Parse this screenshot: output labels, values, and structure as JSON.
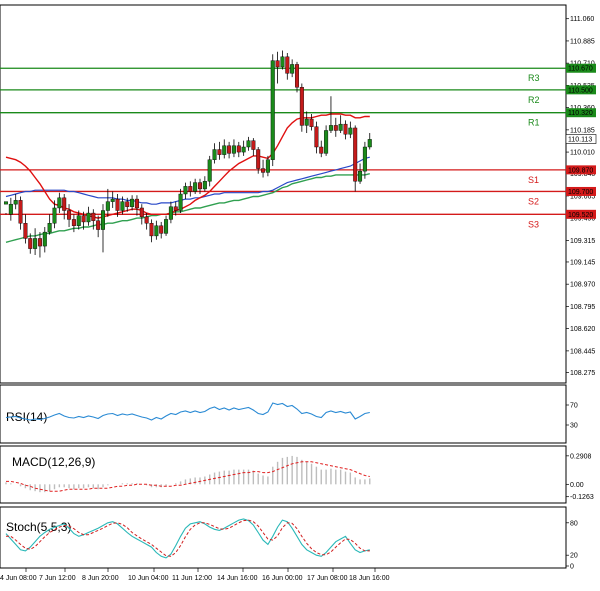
{
  "chart_data": [
    {
      "type": "candlestick",
      "pane": "price",
      "ylim": [
        108.2,
        111.16
      ],
      "y_ticks": [
        "111.060",
        "110.885",
        "110.710",
        "110.535",
        "110.360",
        "110.185",
        "110.010",
        "109.840",
        "109.665",
        "109.490",
        "109.315",
        "109.145",
        "108.970",
        "108.795",
        "108.620",
        "108.445",
        "108.275"
      ],
      "last_price": "110.113",
      "levels": [
        {
          "name": "R3",
          "value": 110.67,
          "label": "110.670",
          "color": "#1a8a1a"
        },
        {
          "name": "R2",
          "value": 110.5,
          "label": "110.500",
          "color": "#1a8a1a"
        },
        {
          "name": "R1",
          "value": 110.32,
          "label": "110.320",
          "color": "#1a8a1a"
        },
        {
          "name": "S1",
          "value": 109.87,
          "label": "109.870",
          "color": "#d41a1a"
        },
        {
          "name": "S2",
          "value": 109.7,
          "label": "109.700",
          "color": "#d41a1a"
        },
        {
          "name": "S3",
          "value": 109.52,
          "label": "109.520",
          "color": "#d41a1a"
        }
      ],
      "candles": [
        [
          109.6,
          109.62,
          109.53,
          109.52
        ],
        [
          109.52,
          109.6,
          109.65,
          109.47
        ],
        [
          109.6,
          109.63,
          109.68,
          109.56
        ],
        [
          109.63,
          109.45,
          109.66,
          109.4
        ],
        [
          109.45,
          109.33,
          109.52,
          109.29
        ],
        [
          109.33,
          109.25,
          109.37,
          109.21
        ],
        [
          109.25,
          109.33,
          109.41,
          109.2
        ],
        [
          109.33,
          109.27,
          109.38,
          109.18
        ],
        [
          109.27,
          109.38,
          109.42,
          109.22
        ],
        [
          109.38,
          109.45,
          109.52,
          109.36
        ],
        [
          109.45,
          109.57,
          109.63,
          109.41
        ],
        [
          109.57,
          109.65,
          109.69,
          109.53
        ],
        [
          109.65,
          109.55,
          109.68,
          109.48
        ],
        [
          109.55,
          109.48,
          109.6,
          109.42
        ],
        [
          109.48,
          109.43,
          109.52,
          109.38
        ],
        [
          109.43,
          109.51,
          109.55,
          109.4
        ],
        [
          109.51,
          109.46,
          109.54,
          109.4
        ],
        [
          109.46,
          109.53,
          109.58,
          109.43
        ],
        [
          109.53,
          109.47,
          109.56,
          109.4
        ],
        [
          109.47,
          109.4,
          109.51,
          109.34
        ],
        [
          109.4,
          109.55,
          109.6,
          109.22
        ],
        [
          109.55,
          109.62,
          109.72,
          109.5
        ],
        [
          109.62,
          109.64,
          109.7,
          109.57
        ],
        [
          109.64,
          109.55,
          109.68,
          109.5
        ],
        [
          109.55,
          109.62,
          109.66,
          109.52
        ],
        [
          109.62,
          109.58,
          109.65,
          109.54
        ],
        [
          109.58,
          109.64,
          109.67,
          109.55
        ],
        [
          109.64,
          109.57,
          109.67,
          109.51
        ],
        [
          109.57,
          109.5,
          109.6,
          109.44
        ],
        [
          109.5,
          109.45,
          109.53,
          109.4
        ],
        [
          109.45,
          109.35,
          109.48,
          109.3
        ],
        [
          109.35,
          109.43,
          109.47,
          109.32
        ],
        [
          109.43,
          109.37,
          109.46,
          109.33
        ],
        [
          109.37,
          109.48,
          109.51,
          109.35
        ],
        [
          109.48,
          109.58,
          109.62,
          109.45
        ],
        [
          109.58,
          109.55,
          109.62,
          109.51
        ],
        [
          109.55,
          109.68,
          109.72,
          109.53
        ],
        [
          109.68,
          109.74,
          109.77,
          109.64
        ],
        [
          109.74,
          109.7,
          109.78,
          109.66
        ],
        [
          109.7,
          109.77,
          109.8,
          109.68
        ],
        [
          109.77,
          109.72,
          109.8,
          109.68
        ],
        [
          109.72,
          109.78,
          109.82,
          109.7
        ],
        [
          109.78,
          109.95,
          109.98,
          109.74
        ],
        [
          109.95,
          110.03,
          110.08,
          109.92
        ],
        [
          110.03,
          109.99,
          110.09,
          109.95
        ],
        [
          109.99,
          110.06,
          110.11,
          109.96
        ],
        [
          110.06,
          110.0,
          110.09,
          109.96
        ],
        [
          110.0,
          110.06,
          110.11,
          109.97
        ],
        [
          110.06,
          110.01,
          110.09,
          109.97
        ],
        [
          110.01,
          110.05,
          110.1,
          109.98
        ],
        [
          110.05,
          110.1,
          110.13,
          110.02
        ],
        [
          110.1,
          110.03,
          110.12,
          109.98
        ],
        [
          110.03,
          109.88,
          110.05,
          109.84
        ],
        [
          109.88,
          109.85,
          109.95,
          109.81
        ],
        [
          109.85,
          109.95,
          109.98,
          109.82
        ],
        [
          109.95,
          110.73,
          110.78,
          109.9
        ],
        [
          110.73,
          110.68,
          110.8,
          110.55
        ],
        [
          110.68,
          110.76,
          110.81,
          110.66
        ],
        [
          110.76,
          110.63,
          110.79,
          110.58
        ],
        [
          110.63,
          110.7,
          110.74,
          110.6
        ],
        [
          110.7,
          110.52,
          110.72,
          110.48
        ],
        [
          110.52,
          110.22,
          110.55,
          110.17
        ],
        [
          110.22,
          110.27,
          110.33,
          110.16
        ],
        [
          110.27,
          110.21,
          110.31,
          110.18
        ],
        [
          110.21,
          110.05,
          110.25,
          110.0
        ],
        [
          110.05,
          110.0,
          110.1,
          109.97
        ],
        [
          110.0,
          110.18,
          110.22,
          109.98
        ],
        [
          110.18,
          110.22,
          110.45,
          110.16
        ],
        [
          110.22,
          110.18,
          110.28,
          110.13
        ],
        [
          110.18,
          110.23,
          110.3,
          110.16
        ],
        [
          110.23,
          110.15,
          110.26,
          110.11
        ],
        [
          110.15,
          110.2,
          110.25,
          110.12
        ],
        [
          110.2,
          109.78,
          110.22,
          109.7
        ],
        [
          109.78,
          109.86,
          109.92,
          109.76
        ],
        [
          109.86,
          110.05,
          110.09,
          109.8
        ],
        [
          110.05,
          110.11,
          110.16,
          110.03
        ]
      ],
      "ma_red": [
        109.97,
        109.96,
        109.95,
        109.93,
        109.9,
        109.86,
        109.81,
        109.76,
        109.7,
        109.64,
        109.6,
        109.59,
        109.57,
        109.56,
        109.54,
        109.53,
        109.52,
        109.51,
        109.5,
        109.49,
        109.5,
        109.51,
        109.52,
        109.53,
        109.54,
        109.55,
        109.56,
        109.56,
        109.55,
        109.53,
        109.52,
        109.52,
        109.52,
        109.52,
        109.53,
        109.55,
        109.56,
        109.58,
        109.6,
        109.63,
        109.65,
        109.67,
        109.7,
        109.74,
        109.78,
        109.82,
        109.86,
        109.89,
        109.92,
        109.94,
        109.96,
        109.98,
        109.98,
        109.97,
        109.96,
        110.0,
        110.06,
        110.13,
        110.2,
        110.24,
        110.27,
        110.28,
        110.28,
        110.28,
        110.29,
        110.3,
        110.3,
        110.31,
        110.31,
        110.31,
        110.3,
        110.3,
        110.28,
        110.28,
        110.29,
        110.29
      ],
      "ma_blue": [
        109.66,
        109.67,
        109.68,
        109.69,
        109.7,
        109.7,
        109.71,
        109.71,
        109.71,
        109.71,
        109.71,
        109.71,
        109.71,
        109.7,
        109.7,
        109.69,
        109.68,
        109.67,
        109.66,
        109.65,
        109.65,
        109.65,
        109.65,
        109.64,
        109.64,
        109.63,
        109.63,
        109.62,
        109.61,
        109.61,
        109.6,
        109.6,
        109.61,
        109.61,
        109.61,
        109.62,
        109.63,
        109.64,
        109.64,
        109.65,
        109.65,
        109.66,
        109.67,
        109.68,
        109.68,
        109.69,
        109.69,
        109.69,
        109.69,
        109.69,
        109.69,
        109.69,
        109.69,
        109.7,
        109.7,
        109.71,
        109.73,
        109.75,
        109.77,
        109.78,
        109.79,
        109.8,
        109.81,
        109.82,
        109.83,
        109.84,
        109.85,
        109.86,
        109.87,
        109.88,
        109.89,
        109.9,
        109.92,
        109.94,
        109.96,
        109.97
      ],
      "ma_green": [
        109.3,
        109.31,
        109.32,
        109.33,
        109.34,
        109.35,
        109.35,
        109.36,
        109.37,
        109.37,
        109.38,
        109.39,
        109.39,
        109.4,
        109.41,
        109.41,
        109.42,
        109.42,
        109.43,
        109.44,
        109.44,
        109.45,
        109.45,
        109.46,
        109.47,
        109.47,
        109.48,
        109.49,
        109.49,
        109.5,
        109.51,
        109.51,
        109.52,
        109.52,
        109.53,
        109.54,
        109.54,
        109.55,
        109.56,
        109.57,
        109.57,
        109.58,
        109.59,
        109.6,
        109.61,
        109.61,
        109.62,
        109.63,
        109.63,
        109.64,
        109.65,
        109.66,
        109.66,
        109.67,
        109.68,
        109.69,
        109.71,
        109.73,
        109.74,
        109.76,
        109.77,
        109.78,
        109.79,
        109.8,
        109.81,
        109.81,
        109.82,
        109.82,
        109.83,
        109.83,
        109.83,
        109.83,
        109.83,
        109.83,
        109.83,
        109.84
      ]
    },
    {
      "type": "line",
      "pane": "rsi",
      "title": "RSI(14)",
      "ylim": [
        0,
        100
      ],
      "y_ticks": [
        "70",
        "30"
      ],
      "values": [
        45,
        46,
        47,
        44,
        42,
        40,
        42,
        41,
        43,
        46,
        50,
        53,
        48,
        45,
        44,
        47,
        45,
        48,
        46,
        43,
        49,
        52,
        53,
        49,
        52,
        50,
        52,
        49,
        46,
        44,
        40,
        45,
        42,
        48,
        53,
        51,
        56,
        58,
        55,
        58,
        55,
        57,
        63,
        66,
        61,
        64,
        60,
        64,
        61,
        63,
        65,
        60,
        53,
        51,
        56,
        74,
        71,
        73,
        67,
        69,
        62,
        53,
        55,
        52,
        47,
        45,
        55,
        58,
        55,
        57,
        54,
        56,
        42,
        47,
        53,
        55
      ]
    },
    {
      "type": "bar+line",
      "pane": "macd",
      "title": "MACD(12,26,9)",
      "ylim": [
        -0.16,
        0.33
      ],
      "y_ticks": [
        "0.2908",
        "0.00",
        "-0.1263"
      ],
      "histogram": [
        0.02,
        0.01,
        0.0,
        -0.02,
        -0.04,
        -0.06,
        -0.07,
        -0.08,
        -0.08,
        -0.07,
        -0.05,
        -0.03,
        -0.03,
        -0.04,
        -0.05,
        -0.04,
        -0.04,
        -0.03,
        -0.04,
        -0.05,
        -0.03,
        -0.01,
        0.0,
        0.0,
        0.01,
        0.01,
        0.01,
        0.01,
        0.0,
        -0.01,
        -0.03,
        -0.03,
        -0.03,
        -0.02,
        0.0,
        0.01,
        0.03,
        0.05,
        0.06,
        0.07,
        0.07,
        0.08,
        0.1,
        0.12,
        0.13,
        0.14,
        0.14,
        0.15,
        0.15,
        0.15,
        0.15,
        0.14,
        0.11,
        0.09,
        0.08,
        0.18,
        0.23,
        0.27,
        0.28,
        0.29,
        0.28,
        0.25,
        0.23,
        0.21,
        0.18,
        0.15,
        0.15,
        0.16,
        0.15,
        0.15,
        0.13,
        0.12,
        0.07,
        0.05,
        0.05,
        0.06
      ],
      "signal": [
        0.03,
        0.03,
        0.02,
        0.01,
        -0.01,
        -0.02,
        -0.04,
        -0.05,
        -0.06,
        -0.07,
        -0.07,
        -0.07,
        -0.06,
        -0.05,
        -0.05,
        -0.05,
        -0.05,
        -0.05,
        -0.04,
        -0.04,
        -0.04,
        -0.04,
        -0.03,
        -0.02,
        -0.02,
        -0.01,
        -0.01,
        0.0,
        0.0,
        0.0,
        -0.01,
        -0.01,
        -0.02,
        -0.02,
        -0.02,
        -0.01,
        -0.01,
        0.0,
        0.01,
        0.02,
        0.03,
        0.04,
        0.05,
        0.06,
        0.07,
        0.08,
        0.09,
        0.1,
        0.11,
        0.12,
        0.12,
        0.13,
        0.13,
        0.12,
        0.12,
        0.13,
        0.15,
        0.17,
        0.19,
        0.21,
        0.22,
        0.23,
        0.23,
        0.23,
        0.22,
        0.21,
        0.2,
        0.19,
        0.18,
        0.17,
        0.16,
        0.15,
        0.13,
        0.11,
        0.09,
        0.08
      ]
    },
    {
      "type": "line",
      "pane": "stoch",
      "title": "Stoch(5,5,3)",
      "ylim": [
        0,
        100
      ],
      "y_ticks": [
        "80",
        "20",
        "0"
      ],
      "k": [
        60,
        50,
        40,
        30,
        28,
        35,
        45,
        55,
        62,
        68,
        72,
        75,
        78,
        70,
        60,
        55,
        58,
        62,
        66,
        70,
        75,
        80,
        82,
        78,
        70,
        62,
        55,
        50,
        45,
        40,
        35,
        25,
        18,
        15,
        22,
        38,
        55,
        70,
        78,
        80,
        82,
        78,
        72,
        68,
        66,
        70,
        75,
        80,
        85,
        87,
        84,
        76,
        62,
        48,
        40,
        55,
        72,
        85,
        82,
        70,
        55,
        40,
        30,
        25,
        20,
        18,
        25,
        35,
        45,
        50,
        55,
        42,
        30,
        25,
        28,
        30
      ],
      "d": [
        55,
        55,
        48,
        40,
        33,
        31,
        36,
        45,
        54,
        62,
        67,
        72,
        75,
        74,
        69,
        62,
        58,
        58,
        62,
        66,
        70,
        75,
        79,
        80,
        77,
        71,
        62,
        56,
        50,
        45,
        40,
        33,
        26,
        19,
        18,
        25,
        38,
        54,
        68,
        76,
        80,
        80,
        77,
        73,
        69,
        68,
        70,
        75,
        80,
        84,
        85,
        82,
        74,
        62,
        50,
        48,
        56,
        71,
        80,
        79,
        69,
        55,
        42,
        32,
        25,
        21,
        21,
        26,
        35,
        43,
        50,
        49,
        42,
        33,
        28,
        28
      ]
    }
  ],
  "x_ticks": [
    "4 Jun 08:00",
    "7 Jun 12:00",
    "8 Jun 20:00",
    "10 Jun 04:00",
    "11 Jun 12:00",
    "14 Jun 16:00",
    "16 Jun 00:00",
    "17 Jun 08:00",
    "18 Jun 16:00"
  ],
  "colors": {
    "bull": "#1a8a1a",
    "bear": "#c41a1a",
    "ma_red": "#e01010",
    "ma_blue": "#2848c8",
    "ma_green": "#30a050",
    "rsi": "#2a8ad4",
    "macd_hist": "#bdbdbd",
    "macd_signal": "#e02020",
    "stoch_k": "#2ab8b8",
    "stoch_d": "#d02020"
  }
}
